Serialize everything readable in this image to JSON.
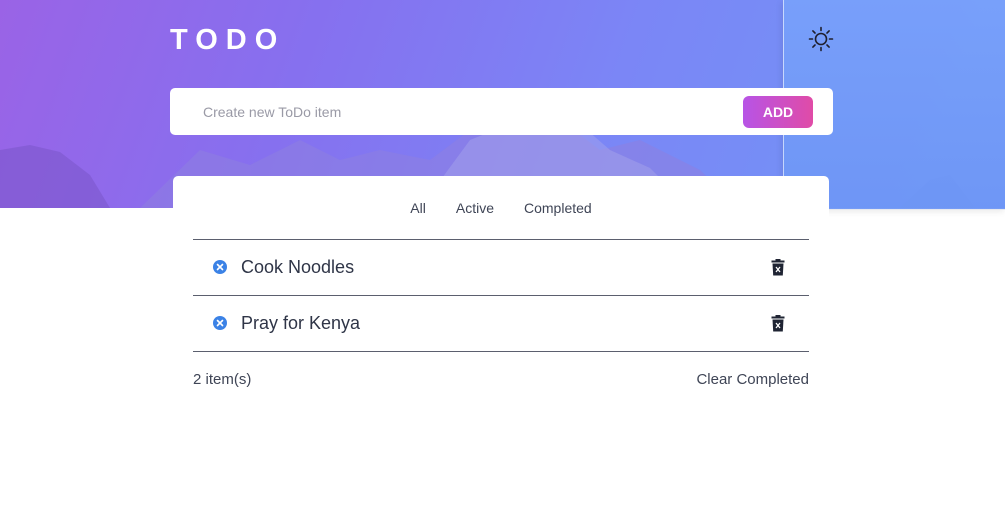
{
  "header": {
    "title": "TODO",
    "theme_icon": "sun-icon"
  },
  "new_item": {
    "placeholder": "Create new ToDo item",
    "value": "",
    "add_label": "ADD"
  },
  "filters": [
    {
      "label": "All"
    },
    {
      "label": "Active"
    },
    {
      "label": "Completed"
    }
  ],
  "todos": [
    {
      "text": "Cook Noodles",
      "status_icon": "x-circle-icon",
      "delete_icon": "trash-icon"
    },
    {
      "text": "Pray for Kenya",
      "status_icon": "x-circle-icon",
      "delete_icon": "trash-icon"
    }
  ],
  "footer": {
    "count_text": "2 item(s)",
    "clear_label": "Clear Completed"
  },
  "colors": {
    "accent_gradient_start": "#b754e6",
    "accent_gradient_end": "#e04ba7",
    "check_blue": "#3b82e6",
    "text": "#2f3547"
  }
}
